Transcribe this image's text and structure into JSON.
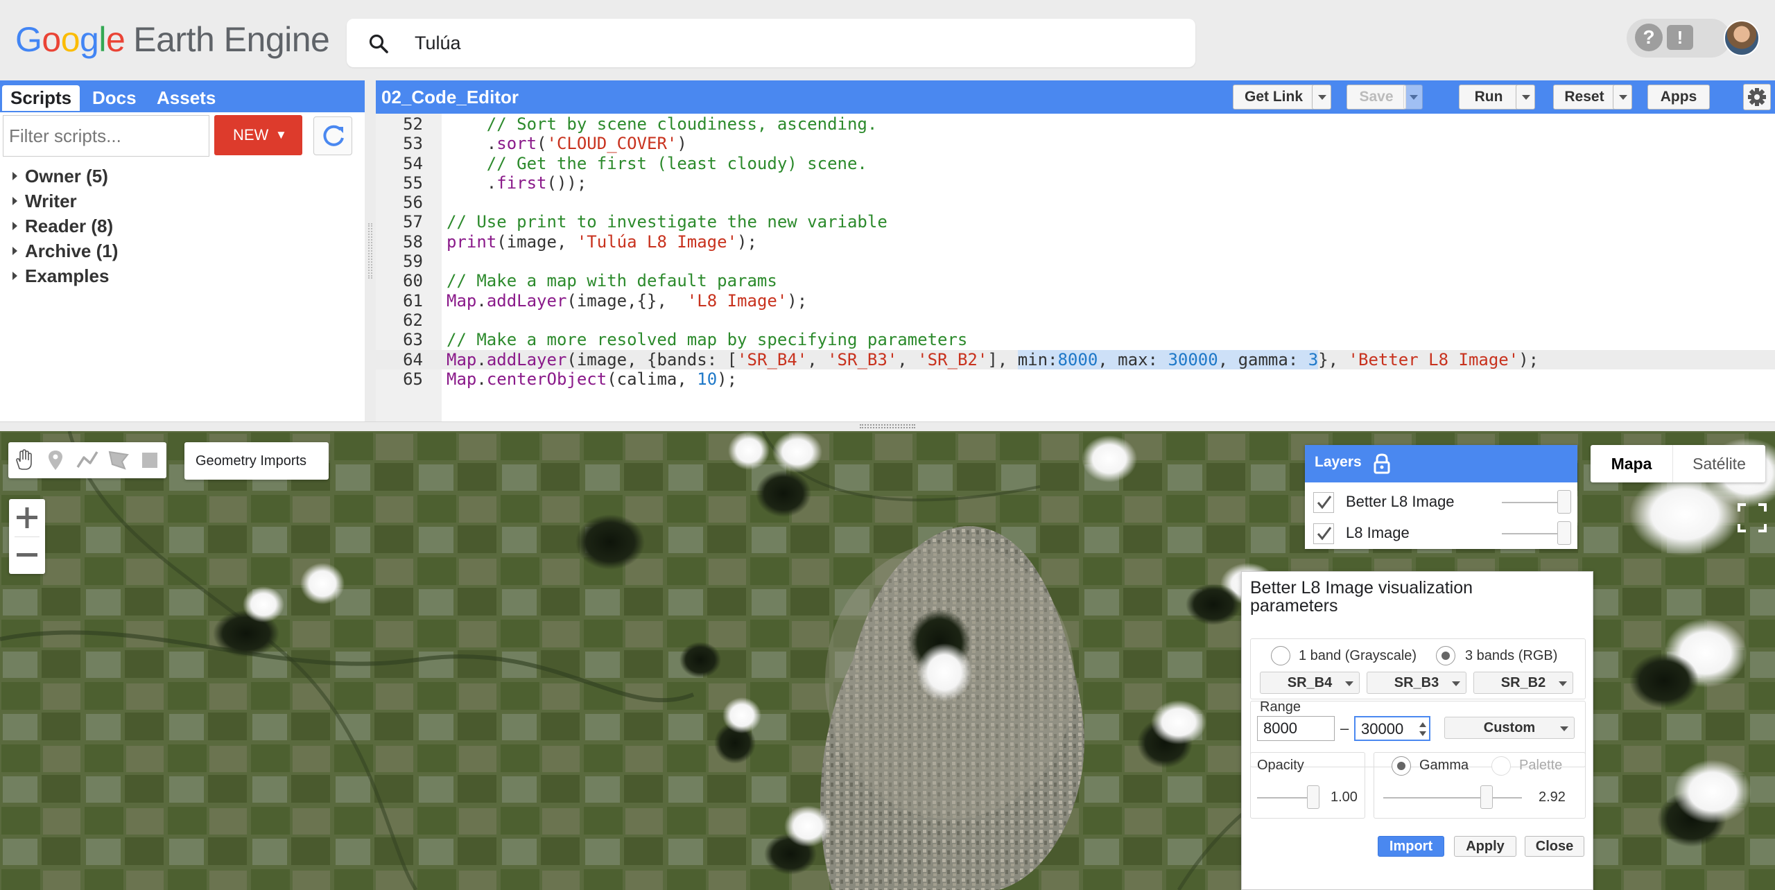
{
  "header": {
    "logo_google": [
      "G",
      "o",
      "o",
      "g",
      "l",
      "e"
    ],
    "logo_product": "Earth Engine",
    "search_value": "Tulúa",
    "help_label": "?",
    "feedback_label": "!"
  },
  "left_panel": {
    "tabs": [
      "Scripts",
      "Docs",
      "Assets"
    ],
    "filter_placeholder": "Filter scripts...",
    "new_button": "NEW",
    "tree": [
      "Owner (5)",
      "Writer",
      "Reader (8)",
      "Archive (1)",
      "Examples"
    ]
  },
  "editor": {
    "filename": "02_Code_Editor",
    "buttons": {
      "get_link": "Get Link",
      "save": "Save",
      "run": "Run",
      "reset": "Reset",
      "apps": "Apps"
    },
    "lines": [
      {
        "n": "52",
        "segs": [
          [
            "    ",
            ""
          ],
          [
            "// Sort by scene cloudiness, ascending.",
            "com"
          ]
        ]
      },
      {
        "n": "53",
        "segs": [
          [
            "    .",
            ""
          ],
          [
            "sort",
            "kw"
          ],
          [
            "(",
            ""
          ],
          [
            "'CLOUD_COVER'",
            "str"
          ],
          [
            ")",
            ""
          ]
        ]
      },
      {
        "n": "54",
        "segs": [
          [
            "    ",
            ""
          ],
          [
            "// Get the first (least cloudy) scene.",
            "com"
          ]
        ]
      },
      {
        "n": "55",
        "segs": [
          [
            "    .",
            ""
          ],
          [
            "first",
            "kw"
          ],
          [
            "());",
            ""
          ]
        ]
      },
      {
        "n": "56",
        "segs": []
      },
      {
        "n": "57",
        "segs": [
          [
            "// Use print to investigate the new variable",
            "com"
          ]
        ]
      },
      {
        "n": "58",
        "segs": [
          [
            "print",
            "kw"
          ],
          [
            "(image, ",
            ""
          ],
          [
            "'Tulúa L8 Image'",
            "str"
          ],
          [
            ");",
            ""
          ]
        ]
      },
      {
        "n": "59",
        "segs": []
      },
      {
        "n": "60",
        "segs": [
          [
            "// Make a map with default params",
            "com"
          ]
        ]
      },
      {
        "n": "61",
        "segs": [
          [
            "Map",
            "kw"
          ],
          [
            ".",
            ""
          ],
          [
            "addLayer",
            "kw"
          ],
          [
            "(image,{},  ",
            ""
          ],
          [
            "'L8 Image'",
            "str"
          ],
          [
            ");",
            ""
          ]
        ]
      },
      {
        "n": "62",
        "segs": []
      },
      {
        "n": "63",
        "segs": [
          [
            "// Make a more resolved map by specifying parameters",
            "com"
          ]
        ]
      },
      {
        "n": "64",
        "current": true,
        "segs": [
          [
            "Map",
            "kw"
          ],
          [
            ".",
            ""
          ],
          [
            "addLayer",
            "kw"
          ],
          [
            "(image, {bands: [",
            ""
          ],
          [
            "'SR_B4'",
            "str"
          ],
          [
            ", ",
            ""
          ],
          [
            "'SR_B3'",
            "str"
          ],
          [
            ", ",
            ""
          ],
          [
            "'SR_B2'",
            "str"
          ],
          [
            "], ",
            ""
          ],
          [
            "min:",
            "sel"
          ],
          [
            "8000",
            "selnum"
          ],
          [
            ", max: ",
            "sel"
          ],
          [
            "30000",
            "selnum"
          ],
          [
            ", gamma: ",
            "sel"
          ],
          [
            "3",
            "selnum"
          ],
          [
            "}, ",
            ""
          ],
          [
            "'Better L8 Image'",
            "str"
          ],
          [
            ");",
            ""
          ]
        ]
      },
      {
        "n": "65",
        "segs": [
          [
            "Map",
            "kw"
          ],
          [
            ".",
            ""
          ],
          [
            "centerObject",
            "kw"
          ],
          [
            "(calima, ",
            ""
          ],
          [
            "10",
            "num"
          ],
          [
            ");",
            ""
          ]
        ]
      }
    ]
  },
  "map": {
    "geometry_imports": "Geometry Imports",
    "zoom_in": "+",
    "zoom_out": "−",
    "layers": {
      "title": "Layers",
      "items": [
        {
          "name": "Better L8 Image",
          "checked": true
        },
        {
          "name": "L8 Image",
          "checked": true
        }
      ]
    },
    "map_types": [
      "Mapa",
      "Satélite"
    ],
    "active_map_type": "Mapa"
  },
  "vis_params": {
    "title": "Better L8 Image visualization parameters",
    "band_mode_1": "1 band (Grayscale)",
    "band_mode_3": "3 bands (RGB)",
    "band_mode_selected": "3 bands (RGB)",
    "bands": [
      "SR_B4",
      "SR_B3",
      "SR_B2"
    ],
    "range_label": "Range",
    "range_min": "8000",
    "range_max": "30000",
    "range_dash": "–",
    "range_preset": "Custom",
    "opacity_label": "Opacity",
    "opacity_value": "1.00",
    "gamma_label": "Gamma",
    "palette_label": "Palette",
    "gamma_value": "2.92",
    "buttons": {
      "import": "Import",
      "apply": "Apply",
      "close": "Close"
    }
  }
}
